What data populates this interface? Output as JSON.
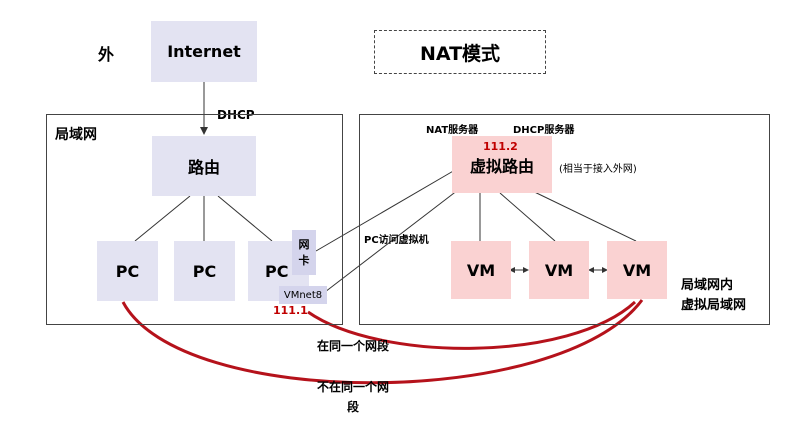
{
  "outside_label": "外",
  "internet": "Internet",
  "mode_title": "NAT模式",
  "dhcp": "DHCP",
  "lan": {
    "title": "局域网",
    "router": "路由",
    "pc1": "PC",
    "pc2": "PC",
    "pc3": "PC",
    "nic": "网\n卡",
    "vmnet": "VMnet8",
    "ip": "111.1"
  },
  "virtual": {
    "nat_server": "NAT服务器",
    "dhcp_server": "DHCP服务器",
    "router_ip": "111.2",
    "router": "虚拟路由",
    "router_note": "(相当于接入外网)",
    "vm1": "VM",
    "vm2": "VM",
    "vm3": "VM",
    "area_label": "局域网内\n虚拟局域网"
  },
  "pc_access": "PC访问虚拟机",
  "same_segment": "在同一个网段",
  "diff_segment": "不在同一个网\n段",
  "colors": {
    "box_lavender": "#e3e3f2",
    "box_pink": "#fad2d2",
    "arc_red": "#b5121b",
    "ip_red": "#c00000"
  }
}
